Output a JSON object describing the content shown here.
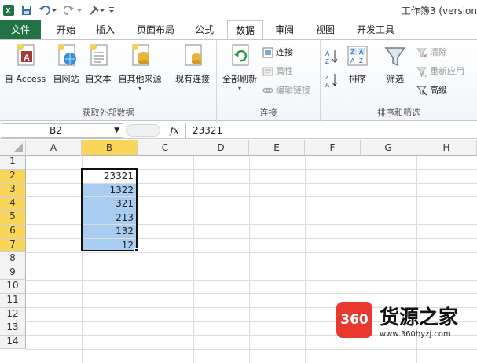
{
  "window": {
    "title": "工作簿3 (version"
  },
  "tabs": [
    "文件",
    "开始",
    "插入",
    "页面布局",
    "公式",
    "数据",
    "审阅",
    "视图",
    "开发工具"
  ],
  "ribbon": {
    "get_external": {
      "label": "获取外部数据",
      "access": "自 Access",
      "web": "自网站",
      "text": "自文本",
      "other": "自其他来源",
      "existing": "现有连接"
    },
    "connections": {
      "label": "连接",
      "refresh_all": "全部刷新",
      "connections": "连接",
      "properties": "属性",
      "edit_links": "编辑链接"
    },
    "sort_filter": {
      "label": "排序和筛选",
      "sort": "排序",
      "filter": "筛选",
      "clear": "清除",
      "reapply": "重新应用",
      "advanced": "高级"
    }
  },
  "formula_bar": {
    "name_box": "B2",
    "fx": "fx",
    "value": "23321"
  },
  "grid": {
    "columns": [
      "A",
      "B",
      "C",
      "D",
      "E",
      "F",
      "G",
      "H"
    ],
    "rows": [
      "1",
      "2",
      "3",
      "4",
      "5",
      "6",
      "7",
      "8",
      "9",
      "10",
      "11",
      "12",
      "13",
      "14"
    ],
    "b_values": [
      "23321",
      "1322",
      "321",
      "213",
      "132",
      "12"
    ]
  },
  "watermark": {
    "logo": "360",
    "name": "货源之家",
    "url": "www.360hyzj.com"
  },
  "colors": {
    "file_tab": "#217346",
    "selection": "#a9cdf0",
    "header_selected": "#f9d55a"
  }
}
